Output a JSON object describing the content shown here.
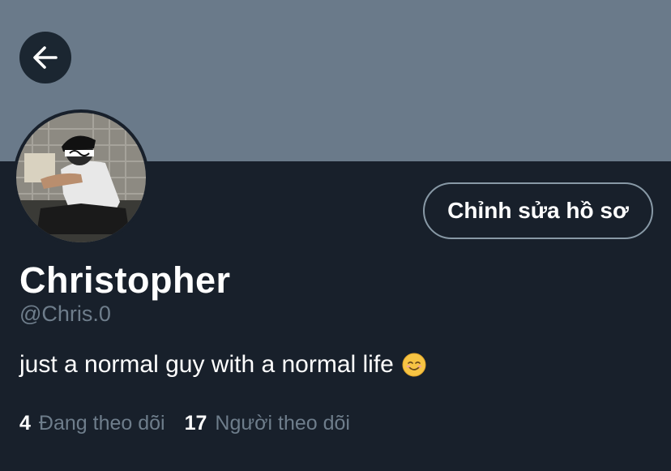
{
  "header": {
    "back_icon": "arrow-left-icon",
    "banner_color": "#6a7a8a"
  },
  "profile": {
    "name": "Christopher",
    "handle": "@Chris.0",
    "bio": "just a normal guy with a normal life",
    "bio_emoji": "smiling-face-icon",
    "edit_label": "Chỉnh sửa hồ sơ"
  },
  "stats": {
    "following_count": "4",
    "following_label": "Đang theo dõi",
    "followers_count": "17",
    "followers_label": "Người theo dõi"
  },
  "colors": {
    "background": "#15202b",
    "secondary_text": "#6e7d8b",
    "border": "#8899a6"
  }
}
